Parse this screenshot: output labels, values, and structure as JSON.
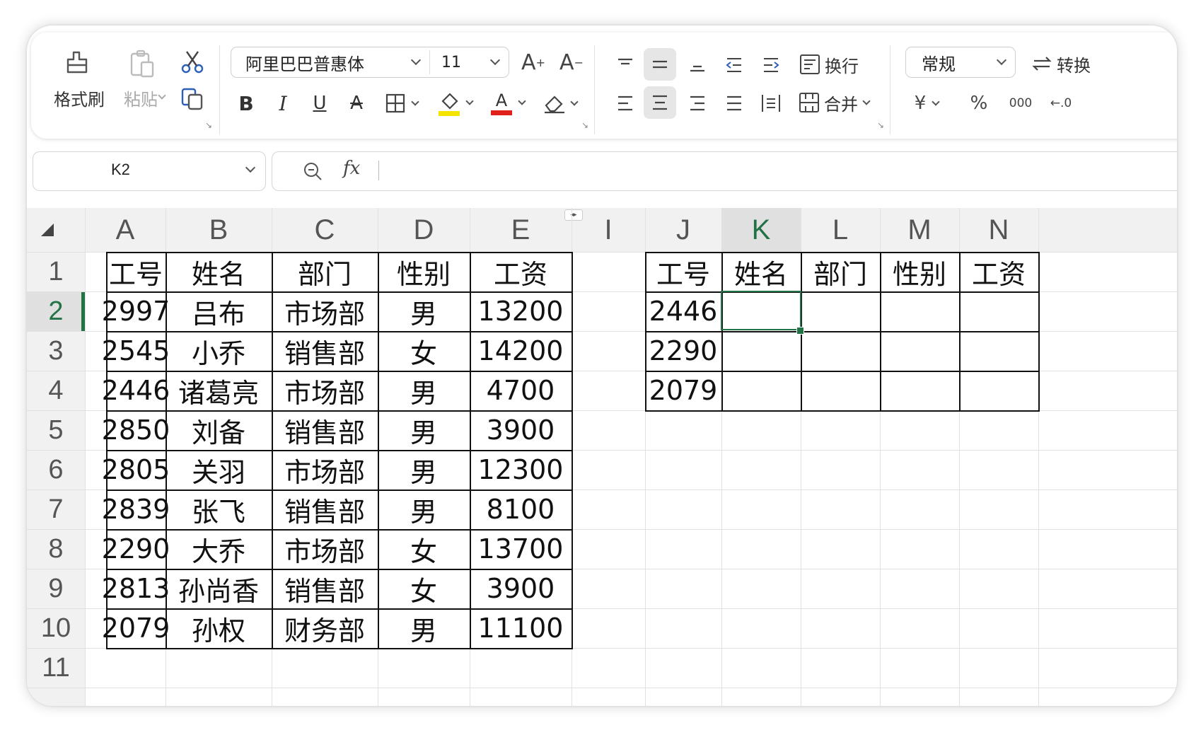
{
  "ribbon": {
    "format_painter_label": "格式刷",
    "paste_label": "粘贴",
    "font_name": "阿里巴巴普惠体",
    "font_size": "11",
    "grow_font": "A",
    "shrink_font": "A",
    "bold": "B",
    "italic": "I",
    "underline": "U",
    "strike": "A",
    "font_color_glyph": "A",
    "wrap_text_label": "换行",
    "merge_label": "合并",
    "number_format": "常规",
    "convert_label": "转换",
    "currency_glyph": "¥",
    "percent_glyph": "%",
    "thousands_glyph": "000",
    "decimal_glyph": "←.0",
    "colors": {
      "highlight": "#f5e400",
      "font_color": "#e0201a",
      "accent": "#217346"
    }
  },
  "formula_bar": {
    "cell_ref": "K2",
    "fx": "fx",
    "formula": ""
  },
  "grid": {
    "selected_cell": "K2",
    "columns": [
      "A",
      "B",
      "C",
      "D",
      "E",
      "I",
      "J",
      "K",
      "L",
      "M",
      "N"
    ],
    "rows": [
      "1",
      "2",
      "3",
      "4",
      "5",
      "6",
      "7",
      "8",
      "9",
      "10",
      "11"
    ],
    "left_table": {
      "headers": [
        "工号",
        "姓名",
        "部门",
        "性别",
        "工资"
      ],
      "rows": [
        [
          "2997",
          "吕布",
          "市场部",
          "男",
          "13200"
        ],
        [
          "2545",
          "小乔",
          "销售部",
          "女",
          "14200"
        ],
        [
          "2446",
          "诸葛亮",
          "市场部",
          "男",
          "4700"
        ],
        [
          "2850",
          "刘备",
          "销售部",
          "男",
          "3900"
        ],
        [
          "2805",
          "关羽",
          "市场部",
          "男",
          "12300"
        ],
        [
          "2839",
          "张飞",
          "销售部",
          "男",
          "8100"
        ],
        [
          "2290",
          "大乔",
          "市场部",
          "女",
          "13700"
        ],
        [
          "2813",
          "孙尚香",
          "销售部",
          "女",
          "3900"
        ],
        [
          "2079",
          "孙权",
          "财务部",
          "男",
          "11100"
        ]
      ]
    },
    "right_table": {
      "headers": [
        "工号",
        "姓名",
        "部门",
        "性别",
        "工资"
      ],
      "rows": [
        [
          "2446",
          "",
          "",
          "",
          ""
        ],
        [
          "2290",
          "",
          "",
          "",
          ""
        ],
        [
          "2079",
          "",
          "",
          "",
          ""
        ]
      ]
    }
  }
}
